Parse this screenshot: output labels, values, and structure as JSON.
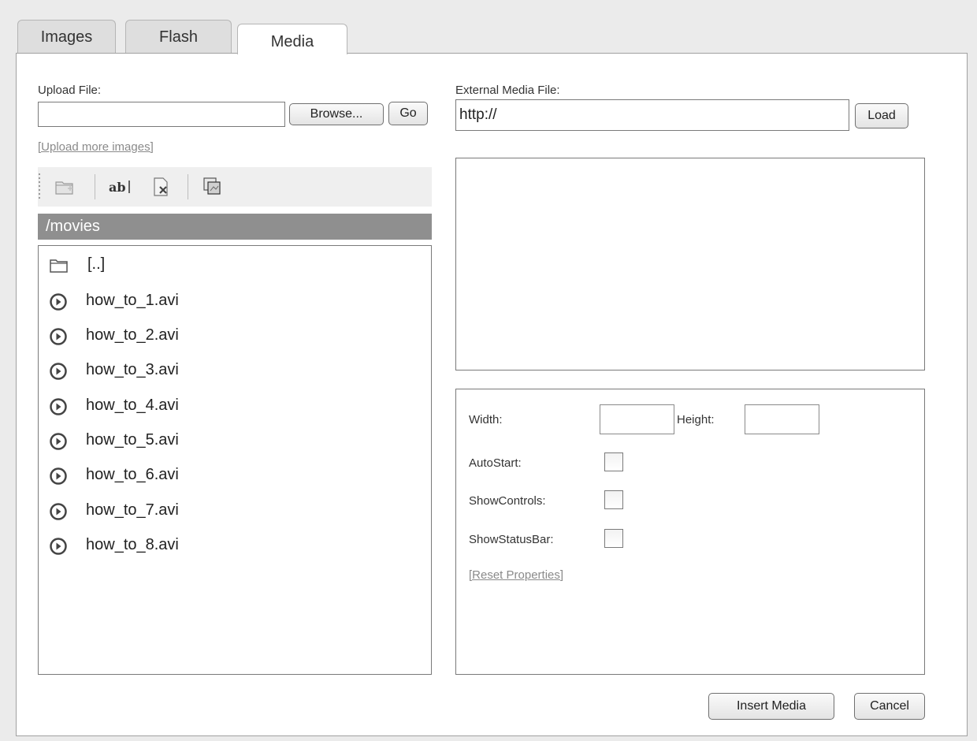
{
  "tabs": [
    {
      "label": "Images",
      "active": false
    },
    {
      "label": "Flash",
      "active": false
    },
    {
      "label": "Media",
      "active": true
    }
  ],
  "upload": {
    "label": "Upload File:",
    "value": "",
    "browse_label": "Browse...",
    "go_label": "Go",
    "more_link": "[Upload more images]"
  },
  "toolbar": {
    "icons": [
      "new-folder-icon",
      "rename-icon",
      "delete-icon",
      "copy-icon"
    ]
  },
  "browser": {
    "path": "/movies",
    "items": [
      {
        "name": "[..]",
        "icon": "folder-icon"
      },
      {
        "name": "how_to_1.avi",
        "icon": "play-icon"
      },
      {
        "name": "how_to_2.avi",
        "icon": "play-icon"
      },
      {
        "name": "how_to_3.avi",
        "icon": "play-icon"
      },
      {
        "name": "how_to_4.avi",
        "icon": "play-icon"
      },
      {
        "name": "how_to_5.avi",
        "icon": "play-icon"
      },
      {
        "name": "how_to_6.avi",
        "icon": "play-icon"
      },
      {
        "name": "how_to_7.avi",
        "icon": "play-icon"
      },
      {
        "name": "how_to_8.avi",
        "icon": "play-icon"
      }
    ]
  },
  "external": {
    "label": "External Media File:",
    "value": "http://",
    "load_label": "Load"
  },
  "properties": {
    "width_label": "Width:",
    "width_value": "",
    "height_label": "Height:",
    "height_value": "",
    "autostart_label": "AutoStart:",
    "autostart_checked": false,
    "showcontrols_label": "ShowControls:",
    "showcontrols_checked": false,
    "showstatusbar_label": "ShowStatusBar:",
    "showstatusbar_checked": false,
    "reset_link": "[Reset Properties]"
  },
  "actions": {
    "insert_label": "Insert Media",
    "cancel_label": "Cancel"
  },
  "colors": {
    "path_bar": "#8f8f8f",
    "background": "#ebebeb",
    "link": "#8a8a8a"
  }
}
